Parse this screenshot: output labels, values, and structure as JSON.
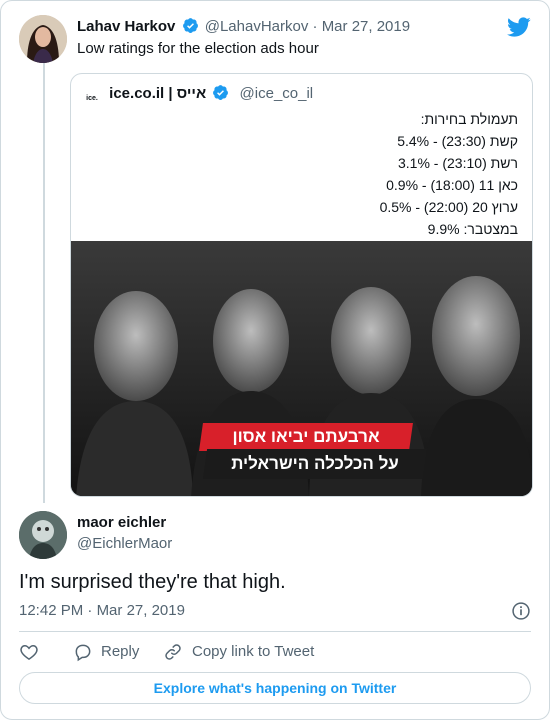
{
  "colors": {
    "twitter_blue": "#1d9bf0",
    "text_primary": "#0f1419",
    "text_secondary": "#536471",
    "border": "#cfd9de",
    "banner_red": "#d8202a"
  },
  "parent_tweet": {
    "author_name": "Lahav Harkov",
    "verified": true,
    "handle": "@LahavHarkov",
    "separator": "·",
    "date": "Mar 27, 2019",
    "text": "Low ratings for the election ads hour",
    "logo_icon": "twitter-bird-icon",
    "quoted": {
      "logo_label": "ice.",
      "author_name": "ice.co.il | אייס",
      "verified": true,
      "handle": "@ice_co_il",
      "lines": [
        "תעמולת בחירות:",
        "קשת (23:30) - 5.4%",
        "רשת (23:10) - 3.1%",
        "כאן 11 (18:00) - 0.9%",
        "ערוץ 20 (22:00) - 0.5%",
        "במצטבר: 9.9%"
      ],
      "image": {
        "banner_line_1": "ארבעתם יביאו אסון",
        "banner_line_2": "על הכלכלה הישראלית"
      }
    }
  },
  "reply_tweet": {
    "author_name": "maor eichler",
    "handle": "@EichlerMaor",
    "text": "I'm surprised they're that high.",
    "time": "12:42 PM",
    "separator": "·",
    "date": "Mar 27, 2019",
    "info_icon": "info-icon"
  },
  "actions": {
    "like_icon": "heart-icon",
    "reply_label": "Reply",
    "reply_icon": "reply-bubble-icon",
    "copy_label": "Copy link to Tweet",
    "copy_icon": "link-icon"
  },
  "explore_label": "Explore what's happening on Twitter"
}
